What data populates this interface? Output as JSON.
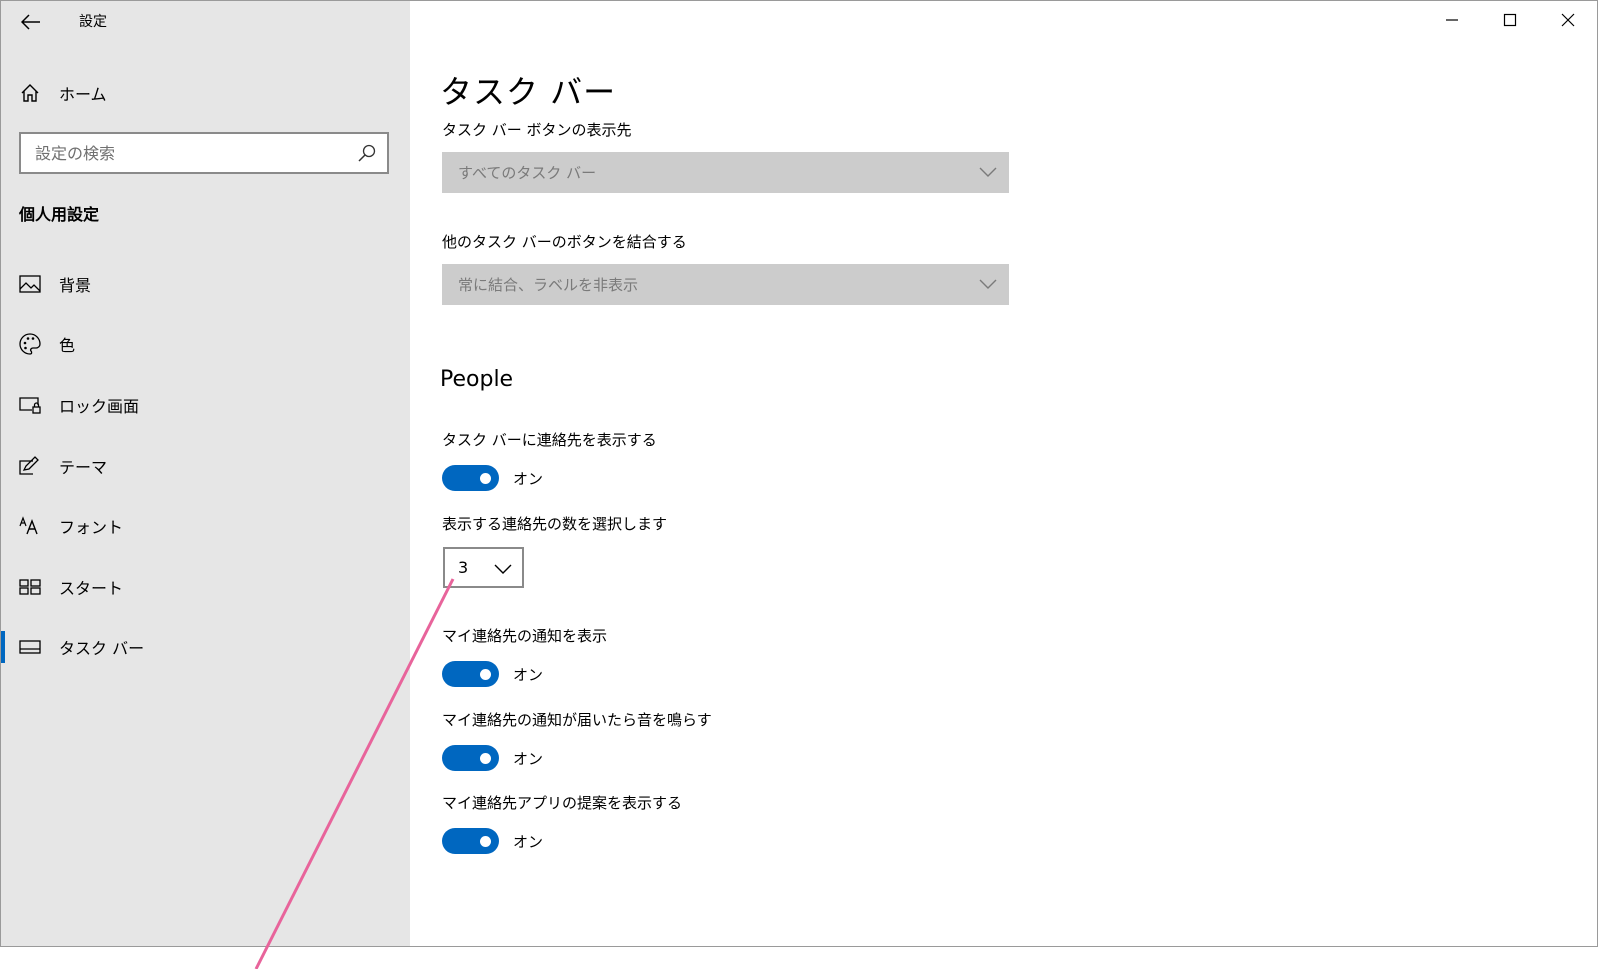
{
  "window": {
    "title": "設定"
  },
  "sidebar": {
    "home_label": "ホーム",
    "search_placeholder": "設定の検索",
    "section_heading": "個人用設定",
    "items": [
      {
        "label": "背景",
        "icon": "image-icon"
      },
      {
        "label": "色",
        "icon": "palette-icon"
      },
      {
        "label": "ロック画面",
        "icon": "lock-screen-icon"
      },
      {
        "label": "テーマ",
        "icon": "theme-icon"
      },
      {
        "label": "フォント",
        "icon": "font-icon"
      },
      {
        "label": "スタート",
        "icon": "start-icon"
      },
      {
        "label": "タスク バー",
        "icon": "taskbar-icon",
        "selected": true
      }
    ]
  },
  "main": {
    "title": "タスク バー",
    "taskbar_buttons_label": "タスク バー ボタンの表示先",
    "taskbar_buttons_value": "すべてのタスク バー",
    "combine_label": "他のタスク バーのボタンを結合する",
    "combine_value": "常に結合、ラベルを非表示",
    "people": {
      "heading": "People",
      "show_contacts_label": "タスク バーに連絡先を表示する",
      "show_contacts_state": "オン",
      "contact_count_label": "表示する連絡先の数を選択します",
      "contact_count_value": "3",
      "show_notifications_label": "マイ連絡先の通知を表示",
      "show_notifications_state": "オン",
      "play_sound_label": "マイ連絡先の通知が届いたら音を鳴らす",
      "play_sound_state": "オン",
      "suggest_apps_label": "マイ連絡先アプリの提案を表示する",
      "suggest_apps_state": "オン"
    }
  },
  "colors": {
    "accent": "#0067c0",
    "sidebar_bg": "#e6e6e6",
    "annotation": "#e8649b"
  }
}
